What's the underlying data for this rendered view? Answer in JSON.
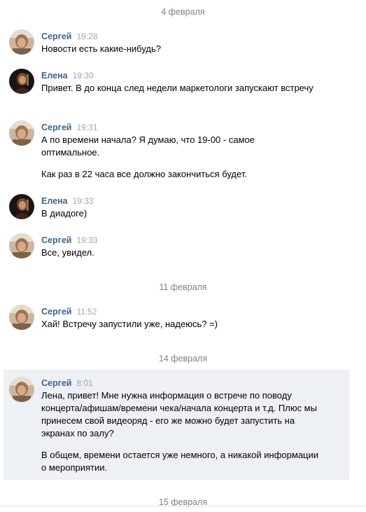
{
  "dates": {
    "feb4": "4 февраля",
    "feb11": "11 февраля",
    "feb14": "14 февраля",
    "feb15": "15 февраля"
  },
  "messages": [
    {
      "author": "Сергей",
      "time": "19:28",
      "paragraphs": [
        "Новости есть какие-нибудь?"
      ]
    },
    {
      "author": "Елена",
      "time": "19:30",
      "paragraphs": [
        "Привет. В до конца след недели маркетологи запускают встречу"
      ]
    },
    {
      "author": "Сергей",
      "time": "19:31",
      "paragraphs": [
        "А по времени начала? Я думаю, что 19-00 - самое оптимальное.",
        "Как раз в 22 часа все должно закончиться будет."
      ]
    },
    {
      "author": "Елена",
      "time": "19:33",
      "paragraphs": [
        "В диадоге)"
      ]
    },
    {
      "author": "Сергей",
      "time": "19:33",
      "paragraphs": [
        "Все, увидел."
      ]
    },
    {
      "author": "Сергей",
      "time": "11:52",
      "paragraphs": [
        "Хай! Встречу запустили уже, надеюсь? =)"
      ]
    },
    {
      "author": "Сергей",
      "time": "8:01",
      "paragraphs": [
        "Лена, привет! Мне нужна информация о встрече по поводу концерта/афишам/времени чека/начала концерта и т.д. Плюс мы принесем свой видеоряд - его же можно будет запустить на экранах по залу?",
        "В общем, времени остается уже немного, а никакой информации о мероприятии."
      ]
    }
  ],
  "colors": {
    "author_name": "#42648b",
    "date_separator": "#828282",
    "timestamp": "#a0a7b0",
    "highlight_background": "#edf0f5"
  },
  "icons": {
    "sergey_avatar": "avatar-sergey-icon",
    "elena_avatar": "avatar-elena-icon"
  }
}
